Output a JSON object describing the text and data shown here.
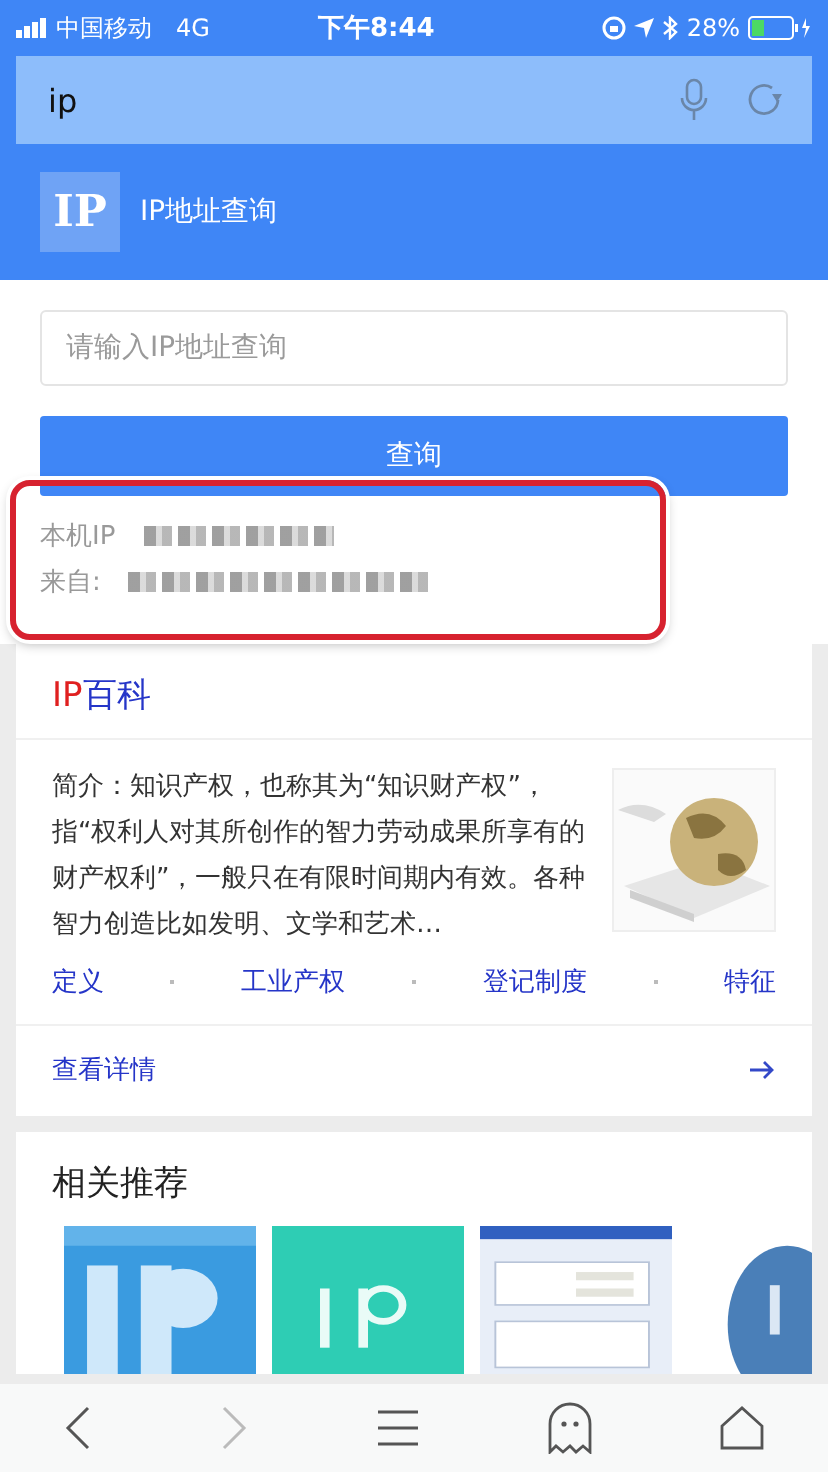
{
  "status_bar": {
    "carrier": "中国移动",
    "network": "4G",
    "time": "下午8:44",
    "battery": "28%"
  },
  "address_bar": {
    "value": "ip"
  },
  "header": {
    "logo": "IP",
    "title": "IP地址查询"
  },
  "lookup": {
    "placeholder": "请输入IP地址查询",
    "button": "查询",
    "local_ip_label": "本机IP",
    "from_label": "来自:"
  },
  "encyclopedia": {
    "title_accent": "IP",
    "title": "百科",
    "summary": "简介：知识产权，也称其为“知识财产权”，指“权利人对其所创作的智力劳动成果所享有的财产权利”，一般只在有限时间期内有效。各种智力创造比如发明、文学和艺术…",
    "links": [
      "定义",
      "工业产权",
      "登记制度",
      "特征"
    ],
    "more": "查看详情"
  },
  "related": {
    "title": "相关推荐"
  }
}
